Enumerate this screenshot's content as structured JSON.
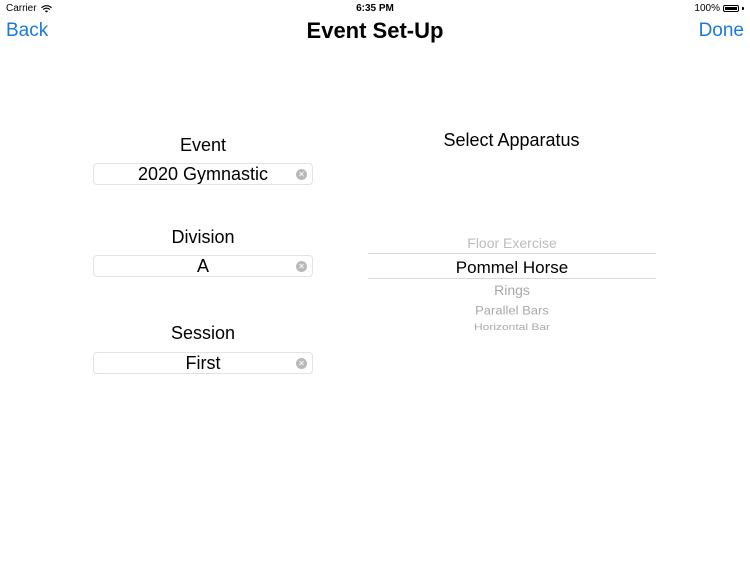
{
  "status_bar": {
    "carrier": "Carrier",
    "time": "6:35 PM",
    "battery": "100%"
  },
  "nav": {
    "back_label": "Back",
    "title": "Event Set-Up",
    "done_label": "Done"
  },
  "form": {
    "event": {
      "label": "Event",
      "value": "2020 Gymnastic"
    },
    "division": {
      "label": "Division",
      "value": "A"
    },
    "session": {
      "label": "Session",
      "value": "First"
    }
  },
  "apparatus": {
    "title": "Select Apparatus",
    "options": [
      "Floor Exercise",
      "Pommel Horse",
      "Rings",
      "Parallel Bars",
      "Horizontal Bar"
    ],
    "selected": "Pommel Horse"
  },
  "icons": {
    "wifi": "wifi-icon",
    "battery": "battery-icon",
    "clear": "clear-icon"
  },
  "colors": {
    "accent": "#1a7ad8"
  }
}
